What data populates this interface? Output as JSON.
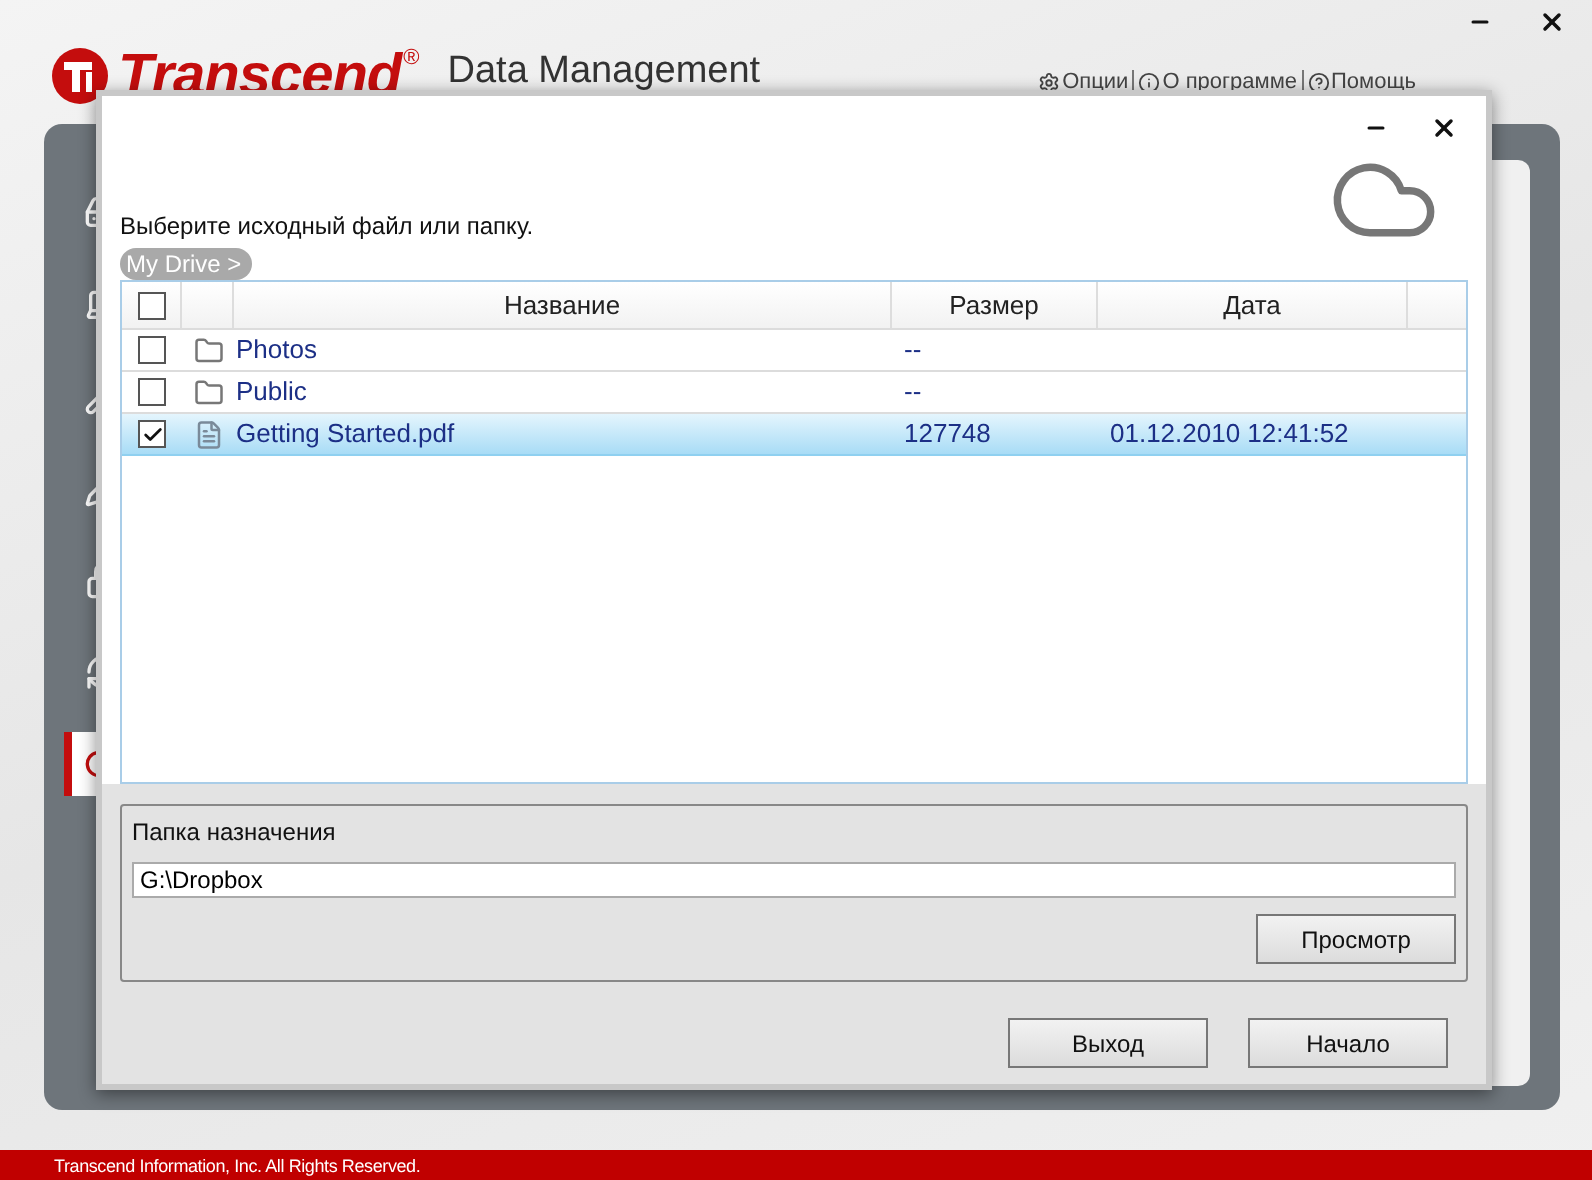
{
  "app": {
    "logo": "Transcend",
    "logo_mark": "®",
    "subtitle": "Data Management",
    "menu": [
      {
        "label": "Опции"
      },
      {
        "label": "О программе"
      },
      {
        "label": "Помощь"
      }
    ]
  },
  "sidebar": {
    "items": [
      {
        "selected": false
      },
      {
        "selected": false
      },
      {
        "selected": false
      },
      {
        "selected": false
      },
      {
        "selected": false
      },
      {
        "selected": false
      },
      {
        "selected": true
      }
    ]
  },
  "dialog": {
    "prompt": "Выберите исходный файл или папку.",
    "breadcrumb": "My Drive >",
    "table": {
      "select_all": false,
      "columns": [
        "Название",
        "Размер",
        "Дата"
      ],
      "rows": [
        {
          "kind": "folder",
          "name": "Photos",
          "size": "--",
          "checked": false,
          "selected": false
        },
        {
          "kind": "folder",
          "name": "Public",
          "size": "--",
          "checked": false,
          "selected": false
        },
        {
          "kind": "file",
          "name": "Getting Started.pdf",
          "size": "127748",
          "date": "01.12.2010 12:41:52",
          "checked": true,
          "selected": true
        }
      ]
    },
    "destination": {
      "label": "Папка назначения",
      "value": "G:\\Dropbox",
      "browse": "Просмотр"
    },
    "buttons": [
      "Выход",
      "Начало"
    ]
  },
  "footer": "Transcend Information, Inc. All Rights Reserved."
}
